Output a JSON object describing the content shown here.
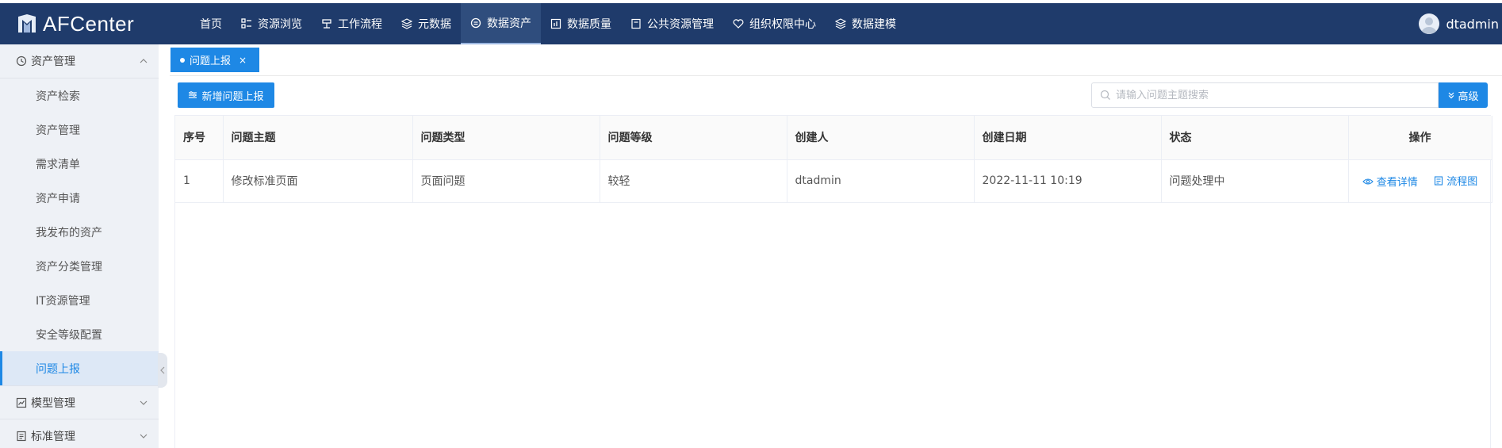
{
  "app": {
    "name": "AFCenter"
  },
  "nav": [
    {
      "label": "首页",
      "icon": "none"
    },
    {
      "label": "资源浏览",
      "icon": "grid-icon"
    },
    {
      "label": "工作流程",
      "icon": "workflow-icon"
    },
    {
      "label": "元数据",
      "icon": "layers-icon"
    },
    {
      "label": "数据资产",
      "icon": "asset-icon",
      "active": true
    },
    {
      "label": "数据质量",
      "icon": "chart-icon"
    },
    {
      "label": "公共资源管理",
      "icon": "book-icon"
    },
    {
      "label": "组织权限中心",
      "icon": "shield-icon"
    },
    {
      "label": "数据建模",
      "icon": "layers-icon"
    }
  ],
  "user": {
    "name": "dtadmin"
  },
  "sidebar": {
    "group1": {
      "label": "资产管理",
      "icon": "clock-icon",
      "expanded": true
    },
    "items": [
      {
        "label": "资产检索"
      },
      {
        "label": "资产管理"
      },
      {
        "label": "需求清单"
      },
      {
        "label": "资产申请"
      },
      {
        "label": "我发布的资产"
      },
      {
        "label": "资产分类管理"
      },
      {
        "label": "IT资源管理"
      },
      {
        "label": "安全等级配置"
      },
      {
        "label": "问题上报",
        "active": true
      }
    ],
    "group2": {
      "label": "模型管理",
      "icon": "trend-icon"
    },
    "group3": {
      "label": "标准管理",
      "icon": "doc-icon"
    }
  },
  "tabs": [
    {
      "label": "问题上报",
      "close": "×"
    }
  ],
  "toolbar": {
    "add_label": "新增问题上报",
    "search_placeholder": "请输入问题主题搜索",
    "search_value": "",
    "advanced_label": "高级"
  },
  "table": {
    "columns": [
      "序号",
      "问题主题",
      "问题类型",
      "问题等级",
      "创建人",
      "创建日期",
      "状态",
      "操作"
    ],
    "rows": [
      {
        "index": "1",
        "subject": "修改标准页面",
        "type": "页面问题",
        "level": "较轻",
        "creator": "dtadmin",
        "created": "2022-11-11 10:19",
        "status": "问题处理中",
        "action_view": "查看详情",
        "action_flow": "流程图"
      }
    ]
  },
  "colors": {
    "topbar": "#1f3b6b",
    "accent": "#1e88e5",
    "sidebar": "#eef1f6"
  }
}
